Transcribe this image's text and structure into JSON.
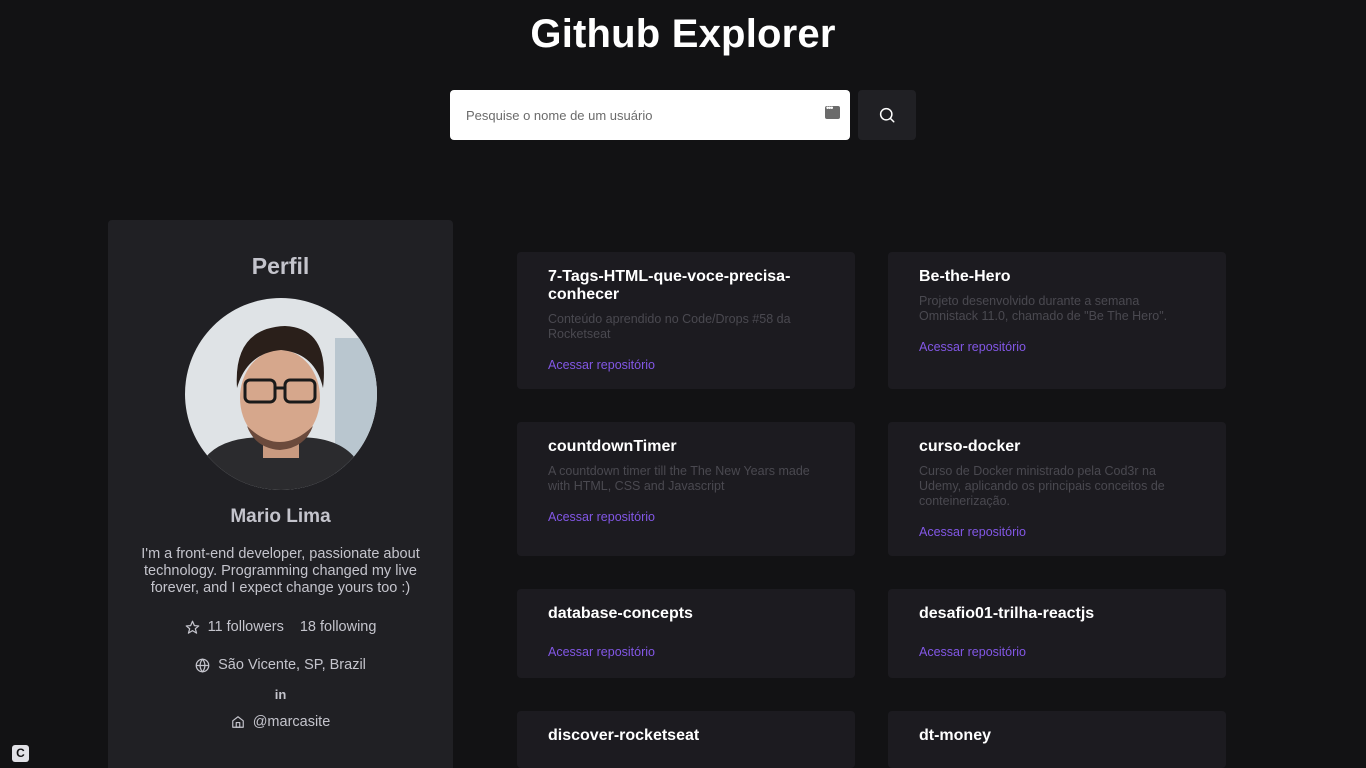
{
  "header": {
    "title": "Github Explorer"
  },
  "search": {
    "placeholder": "Pesquise o nome de um usuário",
    "value": ""
  },
  "profile": {
    "heading": "Perfil",
    "name": "Mario Lima",
    "bio": "I'm a front-end developer, passionate about technology. Programming changed my live forever, and I expect change yours too :)",
    "followers": "11 followers",
    "following": "18 following",
    "location": "São Vicente, SP, Brazil",
    "linkedin_label": "in",
    "site": "@marcasite"
  },
  "repos": [
    {
      "name": "7-Tags-HTML-que-voce-precisa-conhecer",
      "description": "Conteúdo aprendido no Code/Drops #58 da Rocketseat",
      "link": "Acessar repositório"
    },
    {
      "name": "Be-the-Hero",
      "description": "Projeto desenvolvido durante a semana Omnistack 11.0, chamado de \"Be The Hero\".",
      "link": "Acessar repositório"
    },
    {
      "name": "countdownTimer",
      "description": "A countdown timer till the The New Years made with HTML, CSS and Javascript",
      "link": "Acessar repositório"
    },
    {
      "name": "curso-docker",
      "description": "Curso de Docker ministrado pela Cod3r na Udemy, aplicando os principais conceitos de conteinerização.",
      "link": "Acessar repositório"
    },
    {
      "name": "database-concepts",
      "description": "",
      "link": "Acessar repositório"
    },
    {
      "name": "desafio01-trilha-reactjs",
      "description": "",
      "link": "Acessar repositório"
    },
    {
      "name": "discover-rocketseat",
      "description": "",
      "link": ""
    },
    {
      "name": "dt-money",
      "description": "",
      "link": ""
    }
  ],
  "corner_badge": "C",
  "colors": {
    "background": "#121214",
    "card": "#202024",
    "accent": "#8257e5"
  }
}
